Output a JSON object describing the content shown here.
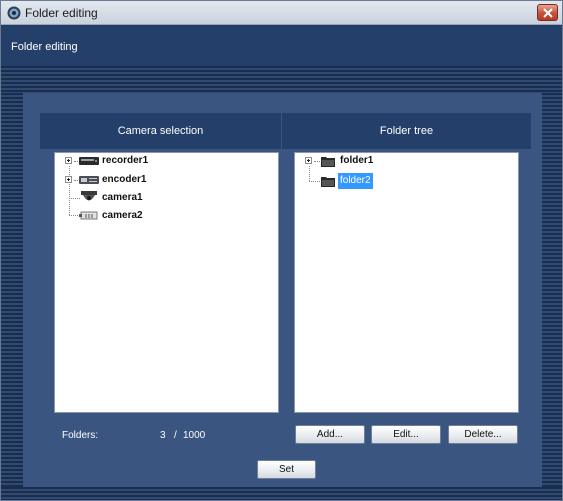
{
  "window": {
    "title": "Folder editing"
  },
  "header": {
    "title": "Folder editing"
  },
  "camera_selection": {
    "heading": "Camera selection",
    "items": [
      {
        "label": "recorder1",
        "icon": "recorder-icon",
        "expandable": true
      },
      {
        "label": "encoder1",
        "icon": "encoder-icon",
        "expandable": true
      },
      {
        "label": "camera1",
        "icon": "dome-camera-icon",
        "expandable": false
      },
      {
        "label": "camera2",
        "icon": "box-camera-icon",
        "expandable": false
      }
    ]
  },
  "folder_tree": {
    "heading": "Folder tree",
    "items": [
      {
        "label": "folder1",
        "icon": "folder-icon",
        "expandable": true,
        "selected": false
      },
      {
        "label": "folder2",
        "icon": "folder-icon",
        "expandable": false,
        "selected": true
      }
    ]
  },
  "folders": {
    "label": "Folders:",
    "count": "3",
    "separator": "/",
    "max": "1000"
  },
  "buttons": {
    "add": "Add...",
    "edit": "Edit...",
    "delete": "Delete...",
    "set": "Set"
  },
  "colors": {
    "selection": "#3399ff",
    "header": "#243f69",
    "content": "#3b5581"
  }
}
